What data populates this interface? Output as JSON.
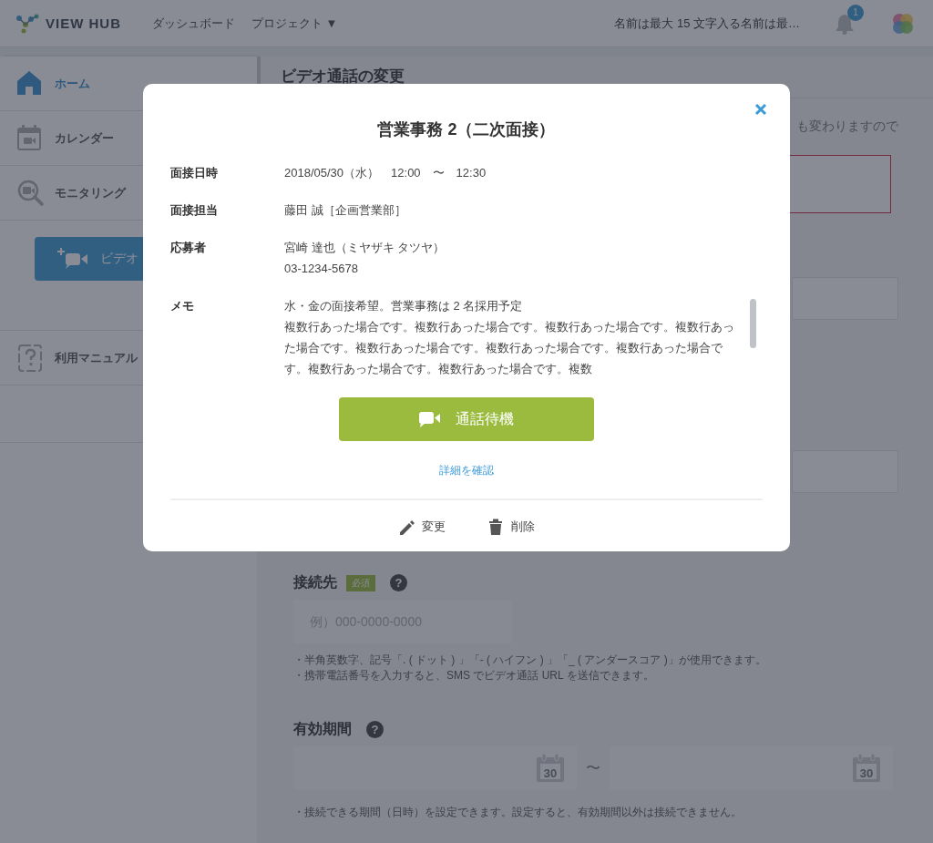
{
  "header": {
    "logo": "VIEW HUB",
    "nav": [
      {
        "label": "ダッシュボード",
        "kind": "link"
      },
      {
        "label": "プロジェクト",
        "kind": "dropdown",
        "caret": "▼"
      }
    ],
    "user_name": "名前は最大 15 文字入る名前は最…",
    "notification_count": "1"
  },
  "sidebar": {
    "items_top": [
      {
        "label": "ホーム",
        "kind": "home",
        "selected": true
      },
      {
        "label": "カレンダー",
        "kind": "calendar",
        "selected": false
      },
      {
        "label": "モニタリング",
        "kind": "monitoring",
        "selected": false
      }
    ],
    "new_call_button": "ビデオ",
    "items_bottom": [
      {
        "label": "利用マニュアル",
        "kind": "manual",
        "selected": false
      }
    ]
  },
  "page": {
    "title": "ビデオ通話の変更",
    "notice": "も変わりますので",
    "contact": {
      "label": "接続先",
      "required": "必須",
      "help_icon": "?",
      "placeholder": "例）000-0000-0000",
      "hints": [
        "・半角英数字、記号「. ( ドット ) 」「- ( ハイフン ) 」「_ ( アンダースコア )」が使用できます。",
        "・携帯電話番号を入力すると、SMS でビデオ通話 URL を送信できます。"
      ]
    },
    "validity": {
      "label": "有効期間",
      "help_icon": "?",
      "fields": [
        {
          "day": "30"
        },
        {
          "day": "30"
        }
      ],
      "separator": "〜",
      "hint": "・接続できる期間（日時）を設定できます。設定すると、有効期間以外は接続できません。"
    }
  },
  "modal": {
    "title": "営業事務 2（二次面接）",
    "rows": [
      {
        "label": "面接日時",
        "kind": "text",
        "lines": [
          "2018/05/30（水）　12:00　〜　12:30"
        ]
      },
      {
        "label": "面接担当",
        "kind": "text",
        "lines": [
          "藤田 誠［企画営業部］"
        ]
      },
      {
        "label": "応募者",
        "kind": "text",
        "lines": [
          "宮崎 達也（ミヤザキ タツヤ）",
          "03-1234-5678"
        ]
      },
      {
        "label": "メモ",
        "kind": "scroll",
        "lines": [
          "水・金の面接希望。営業事務は 2 名採用予定",
          "複数行あった場合です。複数行あった場合です。複数行あった場合です。複数行あった場合です。複数行あった場合です。複数行あった場合です。複数行あった場合です。複数行あった場合です。複数行あった場合です。複数"
        ]
      }
    ],
    "primary_button": "通話待機",
    "detail_link": "詳細を確認",
    "actions": [
      {
        "label": "変更",
        "kind": "edit"
      },
      {
        "label": "削除",
        "kind": "delete"
      }
    ]
  }
}
